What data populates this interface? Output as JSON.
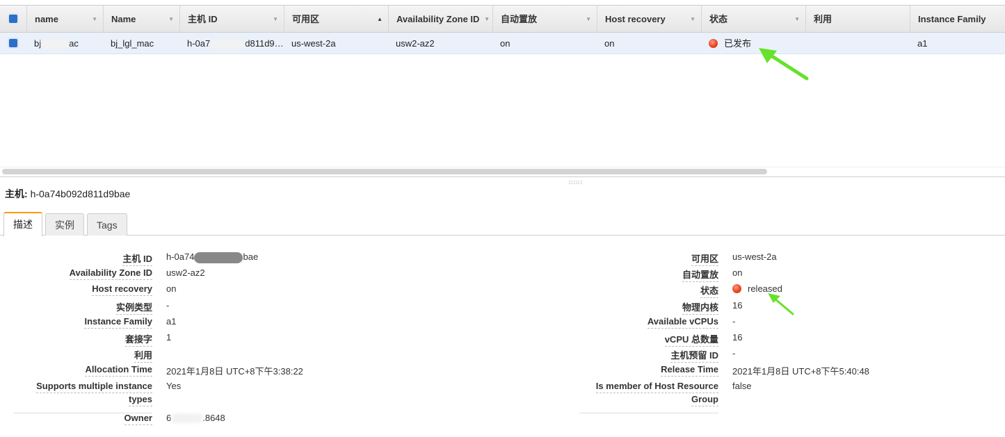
{
  "grid": {
    "columns": [
      {
        "label": "name",
        "sort": "▼"
      },
      {
        "label": "Name",
        "sort": "▼"
      },
      {
        "label": "主机 ID",
        "sort": "▼"
      },
      {
        "label": "可用区",
        "sort": "▲"
      },
      {
        "label": "Availability Zone ID",
        "sort": "▼"
      },
      {
        "label": "自动置放",
        "sort": "▼"
      },
      {
        "label": "Host recovery",
        "sort": "▼"
      },
      {
        "label": "状态",
        "sort": "▼"
      },
      {
        "label": "利用",
        "sort": ""
      },
      {
        "label": "Instance Family",
        "sort": ""
      }
    ],
    "row": {
      "name_start": "bj",
      "name_end": "ac",
      "Name": "bj_lgl_mac",
      "host_id_start": "h-0a7",
      "host_id_end": "d811d9…",
      "zone": "us-west-2a",
      "zone_id": "usw2-az2",
      "auto_placement": "on",
      "host_recovery": "on",
      "state": "已发布",
      "state_color": "#e8401c",
      "utilization": "",
      "instance_family": "a1"
    }
  },
  "detail": {
    "title_label": "主机:",
    "title_value": "h-0a74b092d811d9bae",
    "tabs": [
      "描述",
      "实例",
      "Tags"
    ],
    "left": [
      {
        "label": "主机 ID",
        "value_start": "h-0a74",
        "value_end": "bae"
      },
      {
        "label": "Availability Zone ID",
        "value": "usw2-az2"
      },
      {
        "label": "Host recovery",
        "value": "on"
      },
      {
        "label": "实例类型",
        "value": "-"
      },
      {
        "label": "Instance Family",
        "value": "a1"
      },
      {
        "label": "套接字",
        "value": "1"
      },
      {
        "label": "利用",
        "value": ""
      },
      {
        "label": "Allocation Time",
        "value": "2021年1月8日 UTC+8下午3:38:22"
      },
      {
        "label": "Supports multiple instance",
        "label2": "types",
        "value": "Yes"
      },
      {
        "label": "Owner",
        "value_start": "6",
        "value_end": ".8648"
      }
    ],
    "right": [
      {
        "label": "可用区",
        "value": "us-west-2a"
      },
      {
        "label": "自动置放",
        "value": "on"
      },
      {
        "label": "状态",
        "value": "released"
      },
      {
        "label": "物理内核",
        "value": "16"
      },
      {
        "label": "Available vCPUs",
        "value": "-"
      },
      {
        "label": "vCPU 总数量",
        "value": "16"
      },
      {
        "label": "主机预留 ID",
        "value": "-"
      },
      {
        "label": "Release Time",
        "value": "2021年1月8日 UTC+8下午5:40:48"
      },
      {
        "label": "Is member of Host Resource",
        "label2": "Group",
        "value": "false"
      }
    ]
  },
  "annotation_color": "#66e22a"
}
